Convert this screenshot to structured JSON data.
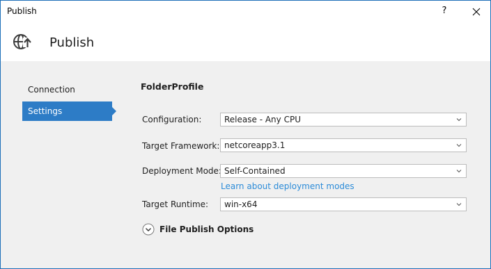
{
  "window": {
    "title": "Publish",
    "help_label": "?",
    "close_label": "✕"
  },
  "header": {
    "title": "Publish",
    "icon": "globe-publish-icon"
  },
  "sidebar": {
    "items": [
      {
        "label": "Connection",
        "active": false
      },
      {
        "label": "Settings",
        "active": true
      }
    ]
  },
  "main": {
    "profile_name": "FolderProfile",
    "fields": {
      "configuration": {
        "label": "Configuration:",
        "value": "Release - Any CPU"
      },
      "framework": {
        "label": "Target Framework:",
        "value": "netcoreapp3.1"
      },
      "deployment": {
        "label": "Deployment Mode:",
        "value": "Self-Contained"
      },
      "runtime": {
        "label": "Target Runtime:",
        "value": "win-x64"
      }
    },
    "deployment_link": "Learn about deployment modes",
    "file_publish_options": "File Publish Options"
  },
  "colors": {
    "accent": "#2d7cc6",
    "link": "#2b8bd8",
    "window_border": "#1c6fb8"
  }
}
